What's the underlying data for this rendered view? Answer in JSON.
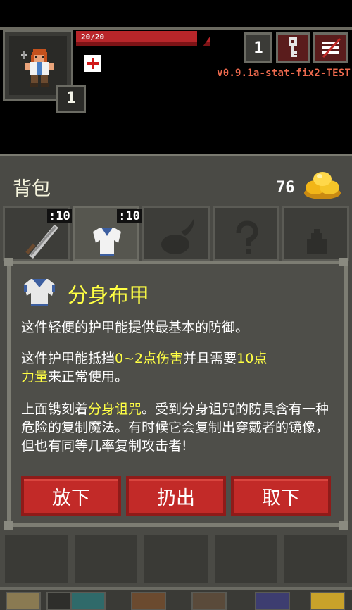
{
  "hud": {
    "hp_text": "20/20",
    "hp_fraction": 1.0,
    "level": "1",
    "depth": "1",
    "version": "v0.9.1a-stat-fix2-TEST"
  },
  "bag": {
    "title": "背包",
    "gold": "76",
    "tabs": [
      {
        "name": "weapon",
        "count": ":10",
        "active": false
      },
      {
        "name": "armor",
        "count": ":10",
        "active": true
      },
      {
        "name": "ring",
        "count": "",
        "active": false
      },
      {
        "name": "unknown",
        "count": "",
        "active": false
      },
      {
        "name": "pouch",
        "count": "",
        "active": false
      }
    ]
  },
  "item": {
    "title": "分身布甲",
    "line1": "这件轻便的护甲能提供最基本的防御。",
    "p2_a": "这件护甲能抵挡",
    "p2_hl1": "0~2点伤害",
    "p2_b": "并且需要",
    "p2_hl2": "10点",
    "p2_hl3": "力量",
    "p2_c": "来正常使用。",
    "p3_a": "上面镌刻着",
    "p3_hl": "分身诅咒",
    "p3_b": "。受到分身诅咒的防具含有一种危险的复制魔法。有时候它会复制出穿戴者的镜像，但也有同等几率复制攻击者!"
  },
  "buttons": {
    "drop": "放下",
    "throw": "扔出",
    "unequip": "取下"
  },
  "colors": {
    "highlight": "#ffff44",
    "button_red": "#c22a28",
    "version_text": "#ee6a4e"
  }
}
